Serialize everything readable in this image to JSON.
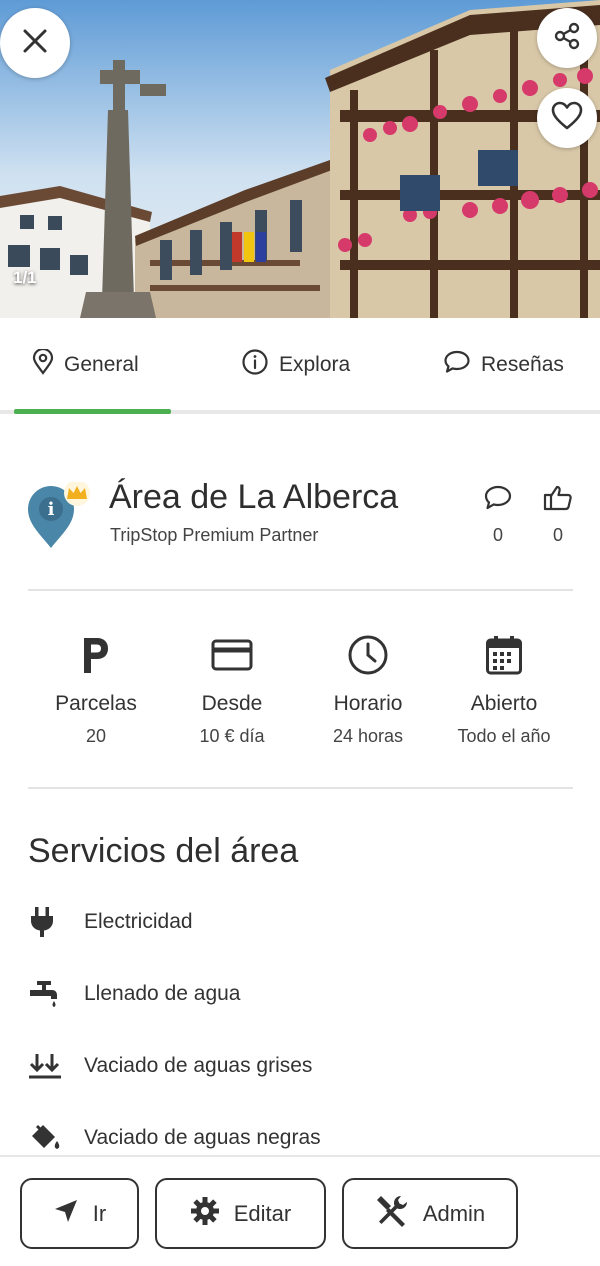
{
  "hero": {
    "image_counter": "1/1",
    "close_icon": "close-icon",
    "share_icon": "share-icon",
    "favorite_icon": "heart-outline-icon"
  },
  "tabs": [
    {
      "label": "General",
      "icon": "location-pin-icon",
      "active": true
    },
    {
      "label": "Explora",
      "icon": "info-circle-icon",
      "active": false
    },
    {
      "label": "Reseñas",
      "icon": "chat-bubble-icon",
      "active": false
    }
  ],
  "colors": {
    "accent": "#4caf50",
    "pin": "#4a86a8",
    "crown": "#f2b01e",
    "text": "#2b2b2b"
  },
  "place": {
    "title": "Área de La Alberca",
    "subtitle": "TripStop Premium Partner",
    "comments_count": "0",
    "likes_count": "0"
  },
  "info": [
    {
      "icon": "parking-icon",
      "label": "Parcelas",
      "value": "20"
    },
    {
      "icon": "credit-card-icon",
      "label": "Desde",
      "value": "10 € día"
    },
    {
      "icon": "clock-icon",
      "label": "Horario",
      "value": "24 horas"
    },
    {
      "icon": "calendar-icon",
      "label": "Abierto",
      "value": "Todo el año"
    }
  ],
  "services": {
    "title": "Servicios del área",
    "items": [
      {
        "icon": "plug-icon",
        "label": "Electricidad"
      },
      {
        "icon": "water-tap-icon",
        "label": "Llenado de agua"
      },
      {
        "icon": "download-arrows-icon",
        "label": "Vaciado de aguas grises"
      },
      {
        "icon": "paint-bucket-icon",
        "label": "Vaciado de aguas negras"
      }
    ]
  },
  "actions": {
    "go_label": "Ir",
    "edit_label": "Editar",
    "admin_label": "Admin"
  }
}
